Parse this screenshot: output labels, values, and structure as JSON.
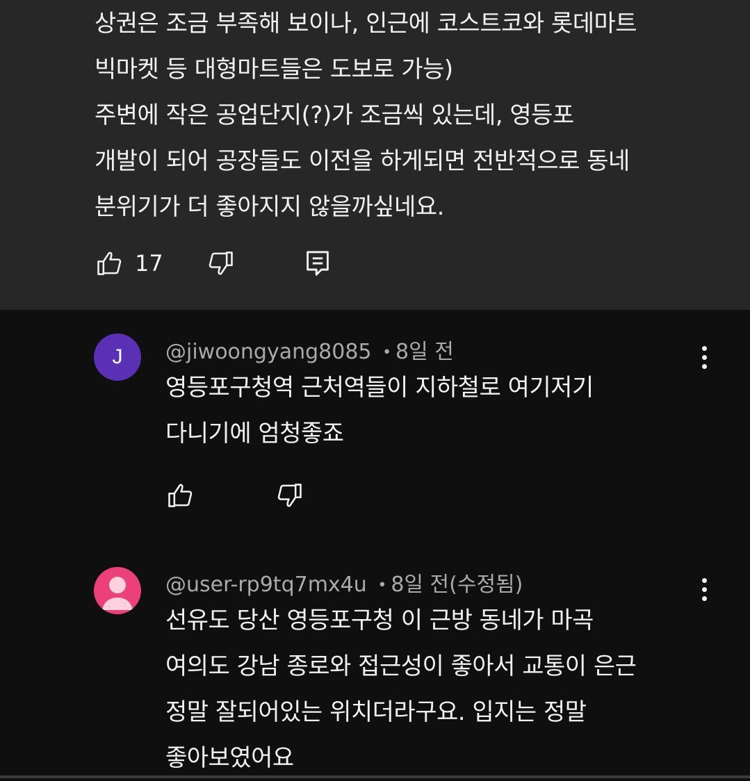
{
  "highlighted_comment": {
    "lines": [
      "상권은 조금 부족해 보이나, 인근에 코스트코와 롯데마트",
      "빅마켓 등 대형마트들은 도보로 가능)",
      "주변에 작은 공업단지(?)가 조금씩 있는데, 영등포",
      "개발이 되어 공장들도 이전을 하게되면 전반적으로 동네",
      "분위기가 더 좋아지지 않을까싶네요."
    ],
    "like_count": "17"
  },
  "replies": [
    {
      "avatar_letter": "J",
      "avatar_color": "#5a31b5",
      "handle": "@jiwoongyang8085",
      "separator": "•",
      "time": "8일 전",
      "lines": [
        "영등포구청역 근처역들이 지하철로 여기저기",
        "다니기에 엄청좋죠"
      ]
    },
    {
      "avatar_color": "#ec407a",
      "handle": "@user-rp9tq7mx4u",
      "separator": "•",
      "time": "8일 전(수정됨)",
      "lines": [
        "선유도 당산 영등포구청 이 근방 동네가 마곡",
        "여의도 강남 종로와 접근성이 좋아서 교통이 은근",
        "정말 잘되어있는 위치더라구요. 입지는 정말",
        "좋아보였어요"
      ]
    }
  ],
  "icons": {
    "like": "thumbs-up-icon",
    "dislike": "thumbs-down-icon",
    "reply": "reply-comment-icon",
    "more": "more-vertical-icon",
    "default_avatar": "person-icon"
  },
  "colors": {
    "highlight_bg": "#272727",
    "page_bg": "#0f0f0f",
    "meta_text": "#aaaaaa"
  }
}
